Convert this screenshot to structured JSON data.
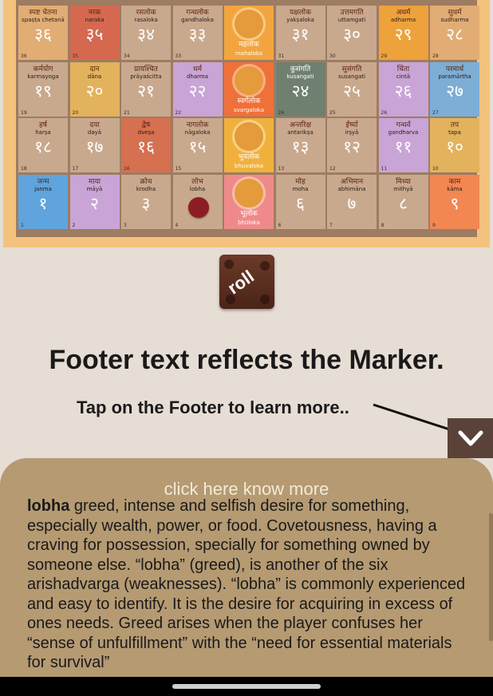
{
  "board": {
    "rows": [
      [
        {
          "dev": "स्पष्ट चेतना",
          "lat": "spaṣṭa chetanā",
          "numdev": "३६",
          "num": "36",
          "color": "#e1ad74"
        },
        {
          "dev": "नरक",
          "lat": "naraka",
          "numdev": "३५",
          "num": "35",
          "color": "#d56950"
        },
        {
          "dev": "रसलोक",
          "lat": "rasaloka",
          "numdev": "३४",
          "num": "34",
          "color": "#c9a98e"
        },
        {
          "dev": "गन्धलोक",
          "lat": "gandhaloka",
          "numdev": "३३",
          "num": "33",
          "color": "#c9a98e"
        },
        {
          "dev": "महलोक",
          "lat": "mahaloka",
          "numdev": "",
          "num": "",
          "color": "#f2a53f",
          "chakra": true
        },
        {
          "dev": "यक्षलोक",
          "lat": "yakṣaloka",
          "numdev": "३१",
          "num": "31",
          "color": "#c9a98e"
        },
        {
          "dev": "उत्तमगति",
          "lat": "uttamgati",
          "numdev": "३०",
          "num": "30",
          "color": "#c9a98e"
        },
        {
          "dev": "अधर्म",
          "lat": "adharma",
          "numdev": "२९",
          "num": "29",
          "color": "#eea23c"
        },
        {
          "dev": "सुधर्म",
          "lat": "sudharma",
          "numdev": "२८",
          "num": "28",
          "color": "#e1ad74"
        }
      ],
      [
        {
          "dev": "कर्मयोग",
          "lat": "karmayoga",
          "numdev": "१९",
          "num": "19",
          "color": "#c9a98e"
        },
        {
          "dev": "दान",
          "lat": "dāna",
          "numdev": "२०",
          "num": "20",
          "color": "#e3b25c"
        },
        {
          "dev": "प्रायश्चित",
          "lat": "prāyaścitta",
          "numdev": "२१",
          "num": "21",
          "color": "#c9a98e"
        },
        {
          "dev": "धर्म",
          "lat": "dharma",
          "numdev": "२२",
          "num": "22",
          "color": "#c8a5d6"
        },
        {
          "dev": "स्वर्गलोक",
          "lat": "svargaloka",
          "numdev": "",
          "num": "",
          "color": "#f0703a",
          "chakra": true
        },
        {
          "dev": "कुसंगति",
          "lat": "kusangati",
          "numdev": "२४",
          "num": "24",
          "color": "#6f8070",
          "dark": true
        },
        {
          "dev": "सुसंगति",
          "lat": "susangati",
          "numdev": "२५",
          "num": "25",
          "color": "#c9a98e"
        },
        {
          "dev": "चिंता",
          "lat": "cintā",
          "numdev": "२६",
          "num": "26",
          "color": "#c8a5d6"
        },
        {
          "dev": "परमार्थ",
          "lat": "paramārtha",
          "numdev": "२७",
          "num": "27",
          "color": "#7daed6"
        }
      ],
      [
        {
          "dev": "हर्ष",
          "lat": "harṣa",
          "numdev": "१८",
          "num": "18",
          "color": "#c9a98e"
        },
        {
          "dev": "दया",
          "lat": "dayā",
          "numdev": "१७",
          "num": "17",
          "color": "#c9a98e"
        },
        {
          "dev": "द्वेष",
          "lat": "dveṣa",
          "numdev": "१६",
          "num": "16",
          "color": "#d57050"
        },
        {
          "dev": "नागलोक",
          "lat": "nāgaloka",
          "numdev": "१५",
          "num": "15",
          "color": "#c9a98e"
        },
        {
          "dev": "भुवलोक",
          "lat": "bhuvaloka",
          "numdev": "",
          "num": "",
          "color": "#f0b13c",
          "chakra": true
        },
        {
          "dev": "अन्तरिक्ष",
          "lat": "antarikṣa",
          "numdev": "१३",
          "num": "13",
          "color": "#c9a98e"
        },
        {
          "dev": "ईर्ष्या",
          "lat": "irṣyā",
          "numdev": "१२",
          "num": "12",
          "color": "#c9a98e"
        },
        {
          "dev": "गन्धर्व",
          "lat": "gandharva",
          "numdev": "११",
          "num": "11",
          "color": "#c8a5d6"
        },
        {
          "dev": "तप",
          "lat": "tapa",
          "numdev": "१०",
          "num": "10",
          "color": "#e3b25c"
        }
      ],
      [
        {
          "dev": "जन्म",
          "lat": "janma",
          "numdev": "१",
          "num": "1",
          "color": "#5fa4dc"
        },
        {
          "dev": "माया",
          "lat": "māyā",
          "numdev": "२",
          "num": "2",
          "color": "#c8a5d6"
        },
        {
          "dev": "क्रोध",
          "lat": "krodha",
          "numdev": "३",
          "num": "3",
          "color": "#c9a98e"
        },
        {
          "dev": "लोभ",
          "lat": "lobha",
          "numdev": "",
          "num": "4",
          "color": "#c9a98e"
        },
        {
          "dev": "भूलोक",
          "lat": "bhūloka",
          "numdev": "",
          "num": "",
          "color": "#ef8a8a",
          "chakra": true
        },
        {
          "dev": "मोह",
          "lat": "moha",
          "numdev": "६",
          "num": "6",
          "color": "#c9a98e"
        },
        {
          "dev": "अभिमान",
          "lat": "abhimāna",
          "numdev": "७",
          "num": "7",
          "color": "#c9a98e"
        },
        {
          "dev": "मिथ्या",
          "lat": "mithyā",
          "numdev": "८",
          "num": "8",
          "color": "#c9a98e"
        },
        {
          "dev": "काम",
          "lat": "kāma",
          "numdev": "९",
          "num": "9",
          "color": "#f28752"
        }
      ]
    ]
  },
  "roll_button": {
    "label": "roll"
  },
  "instructions": {
    "headline": "Footer text reflects the Marker.",
    "subline": "Tap on the Footer to learn more.."
  },
  "footer": {
    "cta": "click here know more",
    "term": "lobha",
    "description": " greed, intense and selfish desire for something, especially wealth, power, or food. Covetousness, having a craving for possession, specially for something owned by someone else. “lobha” (greed), is another of the six arishadvarga (weaknesses). “lobha” is commonly experienced and easy to identify. It is the desire for acquiring in excess of ones needs. Greed arises when the player confuses her “sense of unfulfillment” with the “need for essential materials for survival”"
  },
  "icons": {
    "toggle": "chevron-down-icon",
    "handle": "home-indicator"
  }
}
